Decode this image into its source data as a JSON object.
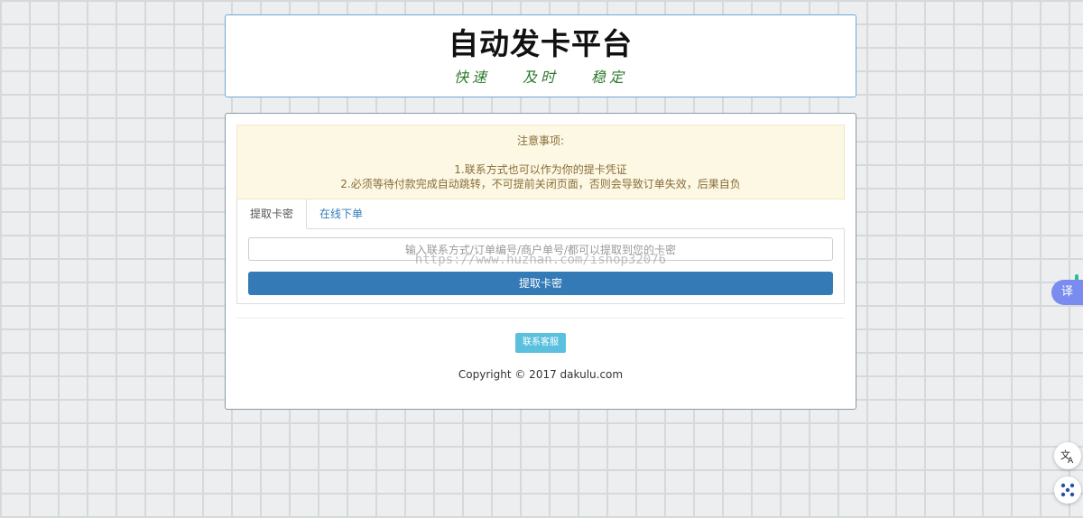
{
  "header": {
    "title": "自动发卡平台",
    "slogan": [
      "快速",
      "及时",
      "稳定"
    ]
  },
  "notice": {
    "heading": "注意事项:",
    "line1": "1.联系方式也可以作为你的提卡凭证",
    "line2": "2.必须等待付款完成自动跳转，不可提前关闭页面，否则会导致订单失效，后果自负"
  },
  "tabs": [
    {
      "label": "提取卡密",
      "active": true
    },
    {
      "label": "在线下单",
      "active": false
    }
  ],
  "form": {
    "input_placeholder": "输入联系方式/订单编号/商户单号/都可以提取到您的卡密",
    "watermark": "https://www.huzhan.com/ishop32076",
    "submit_label": "提取卡密"
  },
  "contact_button": "联系客服",
  "copyright": "Copyright © 2017 dakulu.com",
  "side": {
    "translate_label": "译",
    "icon_translate": "translate-icon",
    "icon_network": "network-icon"
  },
  "colors": {
    "primary": "#337ab7",
    "info": "#5bc0de",
    "notice_bg": "#fcf8e3",
    "slogan": "#2d7a2d"
  }
}
